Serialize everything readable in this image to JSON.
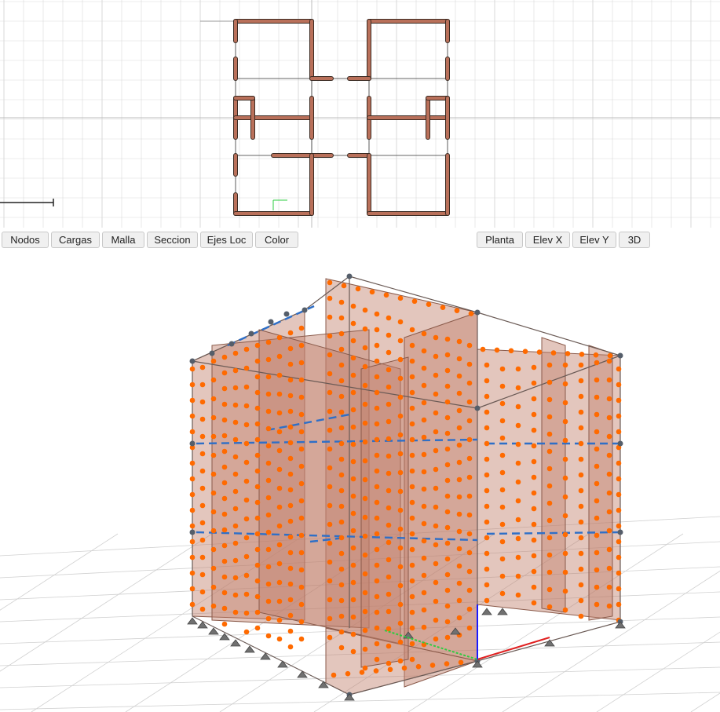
{
  "plan_view": {
    "scale_label": "scale-bar",
    "origin_label": "ejes"
  },
  "toolbar": {
    "left_buttons": [
      "Nodos",
      "Cargas",
      "Malla",
      "Seccion",
      "Ejes Loc",
      "Color"
    ],
    "right_buttons": [
      "Planta",
      "Elev X",
      "Elev Y",
      "3D"
    ]
  },
  "colors": {
    "wall": "#b9705a",
    "wall_fill": "#c0806c",
    "mesh_node": "#ff6a00",
    "node": "#555e6a",
    "beam": "#2e6fc7",
    "axis_x": "#e02020",
    "axis_y": "#2ecc40",
    "axis_z": "#1a1aff",
    "grid": "#d9d9d9"
  }
}
